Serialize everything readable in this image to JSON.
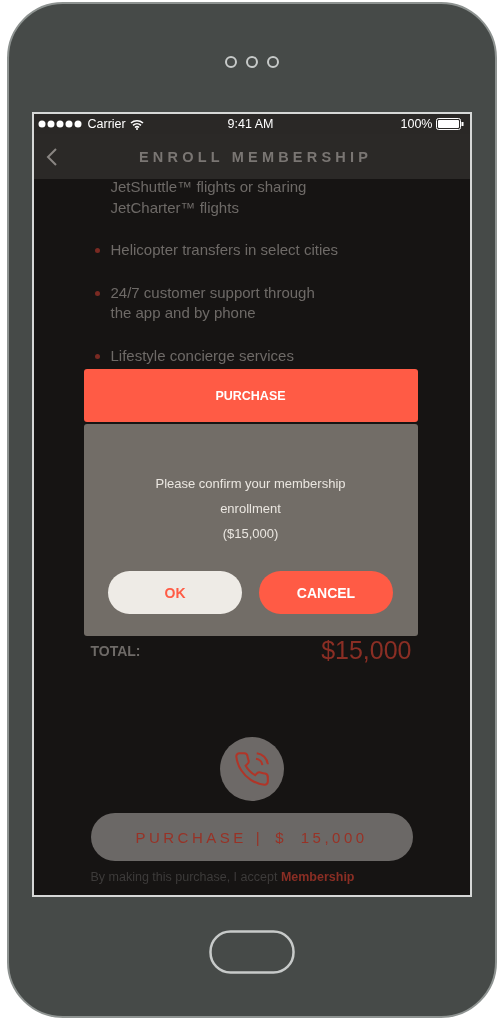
{
  "status_bar": {
    "carrier": "Carrier",
    "time": "9:41 AM",
    "battery": "100%"
  },
  "nav": {
    "title": "ENROLL MEMBERSHIP"
  },
  "benefits": [
    {
      "kind": "continuation",
      "lines": [
        "JetShuttle™ flights or sharing",
        "JetCharter™ flights"
      ]
    },
    {
      "kind": "bullet",
      "lines": [
        "Helicopter transfers in select cities"
      ]
    },
    {
      "kind": "bullet",
      "lines": [
        "24/7 customer support through",
        "the app and by phone"
      ]
    },
    {
      "kind": "bullet",
      "lines": [
        "Lifestyle concierge services"
      ]
    }
  ],
  "total": {
    "label": "TOTAL:",
    "amount": "$15,000"
  },
  "purchase_button": {
    "label": "PURCHASE",
    "separator": "|",
    "amount": "$ 15,000"
  },
  "terms": {
    "text": "By making this purchase, I accept",
    "link": "Membership"
  },
  "dialog": {
    "header": "PURCHASE",
    "message": "Please confirm your membership enrollment",
    "amount": "($15,000)",
    "buttons": [
      {
        "label": "OK",
        "kind": "secondary"
      },
      {
        "label": "CANCEL",
        "kind": "primary"
      }
    ]
  }
}
